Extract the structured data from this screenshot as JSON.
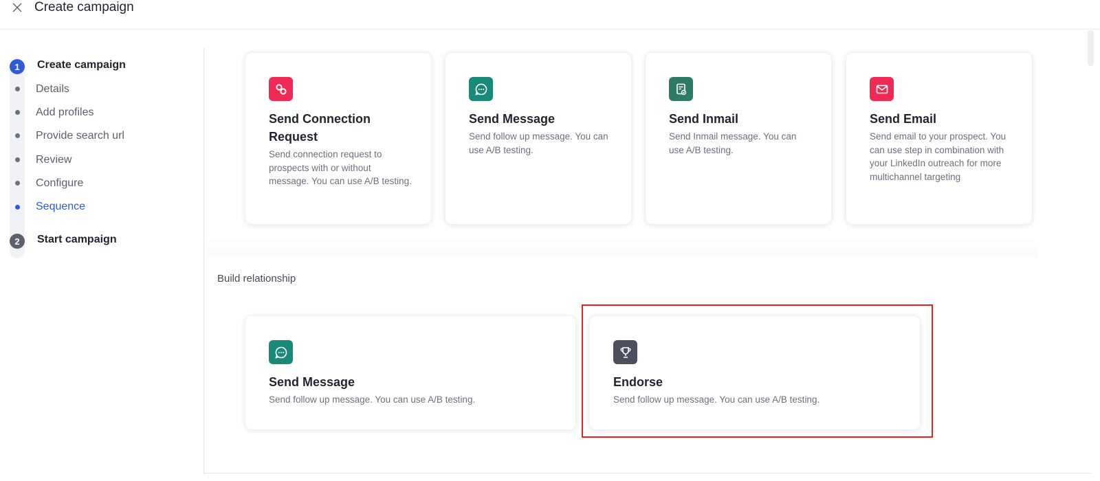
{
  "header": {
    "title": "Create campaign"
  },
  "sidebar": {
    "steps": [
      {
        "number": "1",
        "label": "Create campaign",
        "substeps": [
          {
            "label": "Details"
          },
          {
            "label": "Add profiles"
          },
          {
            "label": "Provide search url"
          },
          {
            "label": "Review"
          },
          {
            "label": "Configure"
          },
          {
            "label": "Sequence"
          }
        ]
      },
      {
        "number": "2",
        "label": "Start campaign"
      }
    ]
  },
  "main": {
    "outreach_cards": [
      {
        "icon": "link-icon",
        "color": "#f02a56",
        "title_lines": [
          "Send Connection",
          "Request"
        ],
        "description": "Send connection request to prospects with or without message. You can use A/B testing."
      },
      {
        "icon": "chat-icon",
        "color": "#1a8a78",
        "title": "Send Message",
        "description": "Send follow up message. You can use A/B testing."
      },
      {
        "icon": "inmail-icon",
        "color": "#2f7a66",
        "title": "Send Inmail",
        "description": "Send Inmail message. You can use A/B testing."
      },
      {
        "icon": "mail-icon",
        "color": "#f02a56",
        "title": "Send Email",
        "description": "Send email to your prospect. You can use step in combination with your LinkedIn outreach for more multichannel targeting"
      }
    ],
    "relationship_section": {
      "label": "Build relationship",
      "cards": [
        {
          "icon": "chat-icon",
          "color": "#1a8a78",
          "title": "Send Message",
          "description": "Send follow up message. You can use A/B testing."
        },
        {
          "icon": "trophy-icon",
          "color": "#4b4f5e",
          "title": "Endorse",
          "description": "Send follow up message. You can use A/B testing."
        }
      ]
    }
  },
  "colors": {
    "accent": "#2f5bd8",
    "highlight": "#e3261c"
  }
}
